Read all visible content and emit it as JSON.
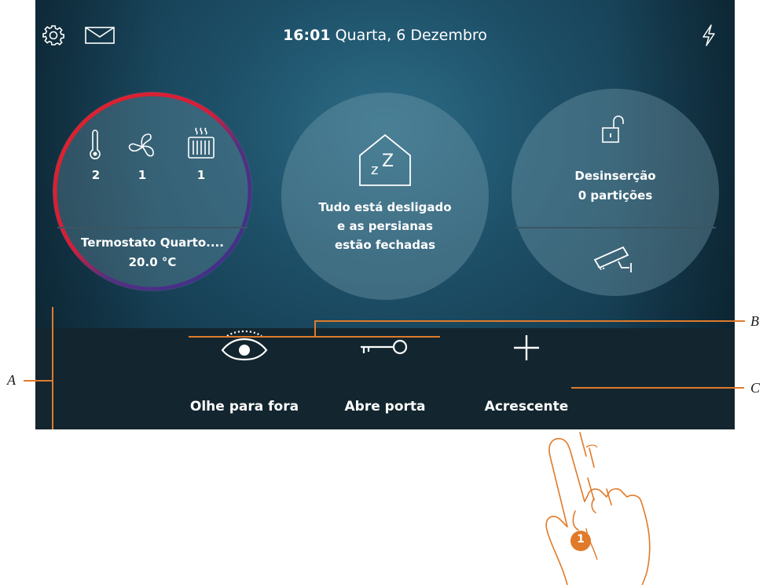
{
  "statusbar": {
    "time": "16:01",
    "date": "Quarta, 6 Dezembro",
    "icons": [
      "gear-icon",
      "mail-icon",
      "lightning-icon"
    ]
  },
  "thermostat_widget": {
    "temperature_count": "2",
    "fan_count": "1",
    "heater_count": "1",
    "name": "Termostato Quarto....",
    "temperature": "20.0 °C",
    "icons": [
      "thermometer-icon",
      "fan-icon",
      "radiator-icon"
    ]
  },
  "scenario_widget": {
    "line1": "Tudo está desligado",
    "line2": "e as persianas",
    "line3": "estão fechadas",
    "icon": "house-sleep-icon"
  },
  "alarm_widget": {
    "status": "Desinserção",
    "partitions": "0 partições",
    "icons": [
      "padlock-open-icon",
      "camera-icon"
    ]
  },
  "actions": [
    {
      "label": "Olhe para fora",
      "icon": "eye-icon"
    },
    {
      "label": "Abre porta",
      "icon": "key-icon"
    },
    {
      "label": "Acrescente",
      "icon": "plus-icon"
    }
  ],
  "callouts": {
    "a": "A",
    "b": "B",
    "c": "C",
    "step": "1"
  },
  "colors": {
    "accent_orange": "#e07a2a",
    "thermostat_ring_hot": "#d9202a",
    "thermostat_ring_cold": "#3a2f8f"
  }
}
